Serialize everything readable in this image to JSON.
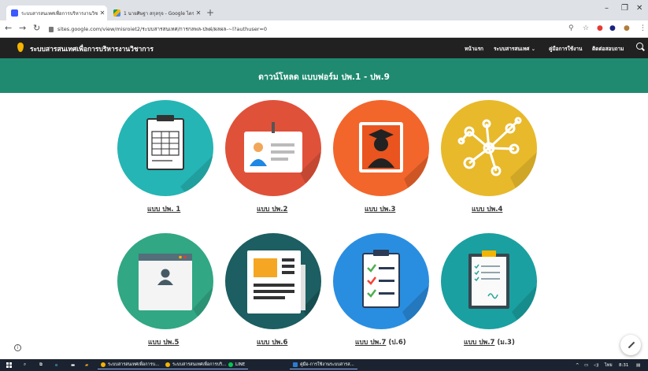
{
  "browser": {
    "tabs": [
      {
        "title": "ระบบสารสนเทศเพื่อการบริหารงานวิชา",
        "active": true
      },
      {
        "title": "1 นายศิษฐา สกุลรุจ - Google ไดรฟ์",
        "active": false
      }
    ],
    "url": "sites.google.com/view/misroiet2/ระบบสารสนเทศ/การกลพล-ปพฝ/ผลผล-~l?authuser=0",
    "window_controls": [
      "–",
      "❐",
      "✕"
    ]
  },
  "site": {
    "title": "ระบบสารสนเทศเพื่อการบริหารงานวิชาการ",
    "nav": [
      {
        "label": "หน้าแรก"
      },
      {
        "label": "ระบบสารสนเทศ ⌄"
      },
      {
        "label": "คู่มือการใช้งาน"
      },
      {
        "label": "ติดต่อสอบถาม"
      }
    ]
  },
  "banner": {
    "title": "ดาวน์โหลด แบบฟอร์ม ปพ.1 - ปพ.9"
  },
  "forms": [
    {
      "label": "แบบ ปพ. 1",
      "suffix": "",
      "icon": "clipboard-form-icon",
      "color": "#25b5b4"
    },
    {
      "label": "แบบ ปพ.2",
      "suffix": "",
      "icon": "id-card-icon",
      "color": "#e0513a"
    },
    {
      "label": "แบบ ปพ.3",
      "suffix": "",
      "icon": "graduate-icon",
      "color": "#f2662c"
    },
    {
      "label": "แบบ ปพ.4",
      "suffix": "",
      "icon": "network-icon",
      "color": "#e8b92b"
    },
    {
      "label": "แบบ ปพ.5",
      "suffix": "",
      "icon": "profile-window-icon",
      "color": "#31a784"
    },
    {
      "label": "แบบ ปพ.6",
      "suffix": "",
      "icon": "document-icon",
      "color": "#1c5e61"
    },
    {
      "label": "แบบ ปพ.7",
      "suffix": " (ป.6)",
      "icon": "checklist-icon",
      "color": "#2a8ee0"
    },
    {
      "label": "แบบ ปพ.7",
      "suffix": " (ม.3)",
      "icon": "checklist-clipboard-icon",
      "color": "#1aa0a0"
    }
  ],
  "taskbar": {
    "apps": [
      {
        "label": "ระบบสารสนเทศเพื่อการบ...",
        "color": "#f5b400"
      },
      {
        "label": "ระบบสารสนเทศเพื่อการบริ...",
        "color": "#f5b400"
      },
      {
        "label": "LINE",
        "color": "#06c755"
      },
      {
        "label": "คู่มือ-การใช้งานระบบสารส...",
        "color": "#2b7cd3"
      }
    ],
    "language": "ไทย",
    "time": "8:31"
  },
  "colors": {
    "header_bg": "#212121",
    "banner_bg": "#1f8a70",
    "taskbar_bg": "#1b2330"
  }
}
